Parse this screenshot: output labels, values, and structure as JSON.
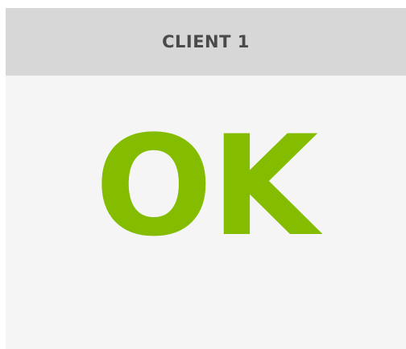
{
  "client_card": {
    "title": "CLIENT 1",
    "status": "OK",
    "status_color": "#84bd00"
  }
}
